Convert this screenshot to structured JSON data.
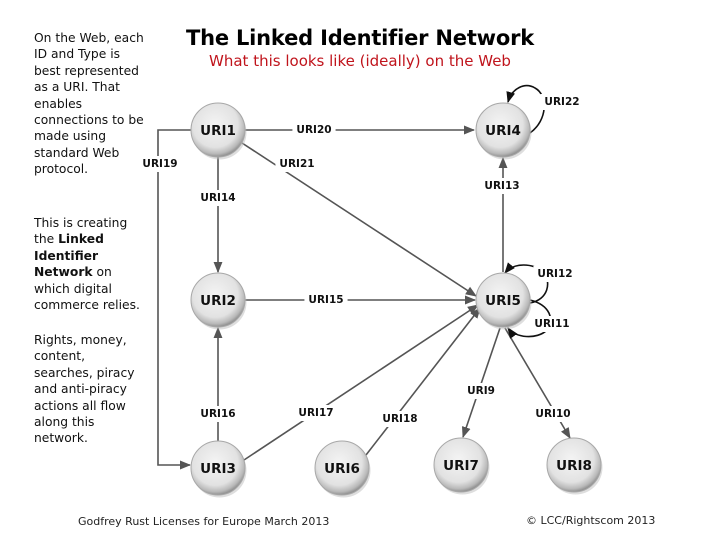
{
  "title": "The Linked Identifier Network",
  "subtitle": "What this looks like (ideally) on the Web",
  "side_text": {
    "p1": "On the Web, each ID and Type is best represented as a URI. That enables connections to be made using standard Web protocol.",
    "p2_pre": "This is creating the ",
    "p2_bold": "Linked Identifier Network",
    "p2_post": " on which digital commerce relies.",
    "p3": "Rights, money, content, searches, piracy and anti-piracy actions all flow along this network."
  },
  "footer": {
    "left": "Godfrey Rust Licenses for Europe March 2013",
    "right": "© LCC/Rightscom 2013"
  },
  "colors": {
    "title": "#000000",
    "subtitle": "#c0141c",
    "edge": "#555555",
    "node_fill": "#e6e6e6"
  },
  "network": {
    "nodes": [
      {
        "id": "URI1",
        "label": "URI1"
      },
      {
        "id": "URI2",
        "label": "URI2"
      },
      {
        "id": "URI3",
        "label": "URI3"
      },
      {
        "id": "URI4",
        "label": "URI4"
      },
      {
        "id": "URI5",
        "label": "URI5"
      },
      {
        "id": "URI6",
        "label": "URI6"
      },
      {
        "id": "URI7",
        "label": "URI7"
      },
      {
        "id": "URI8",
        "label": "URI8"
      }
    ],
    "edges": [
      {
        "label": "URI14",
        "from": "URI1",
        "to": "URI2"
      },
      {
        "label": "URI19",
        "from": "URI1",
        "to": "URI3"
      },
      {
        "label": "URI20",
        "from": "URI1",
        "to": "URI4"
      },
      {
        "label": "URI21",
        "from": "URI1",
        "to": "URI5"
      },
      {
        "label": "URI13",
        "from": "URI5",
        "to": "URI4"
      },
      {
        "label": "URI22",
        "from": "URI4",
        "to": "URI4"
      },
      {
        "label": "URI15",
        "from": "URI2",
        "to": "URI5"
      },
      {
        "label": "URI16",
        "from": "URI3",
        "to": "URI2"
      },
      {
        "label": "URI17",
        "from": "URI3",
        "to": "URI5"
      },
      {
        "label": "URI18",
        "from": "URI6",
        "to": "URI5"
      },
      {
        "label": "URI9",
        "from": "URI5",
        "to": "URI7"
      },
      {
        "label": "URI10",
        "from": "URI5",
        "to": "URI8"
      },
      {
        "label": "URI12",
        "from": "URI5",
        "to": "URI5"
      },
      {
        "label": "URI11",
        "from": "URI5",
        "to": "URI5"
      }
    ]
  }
}
